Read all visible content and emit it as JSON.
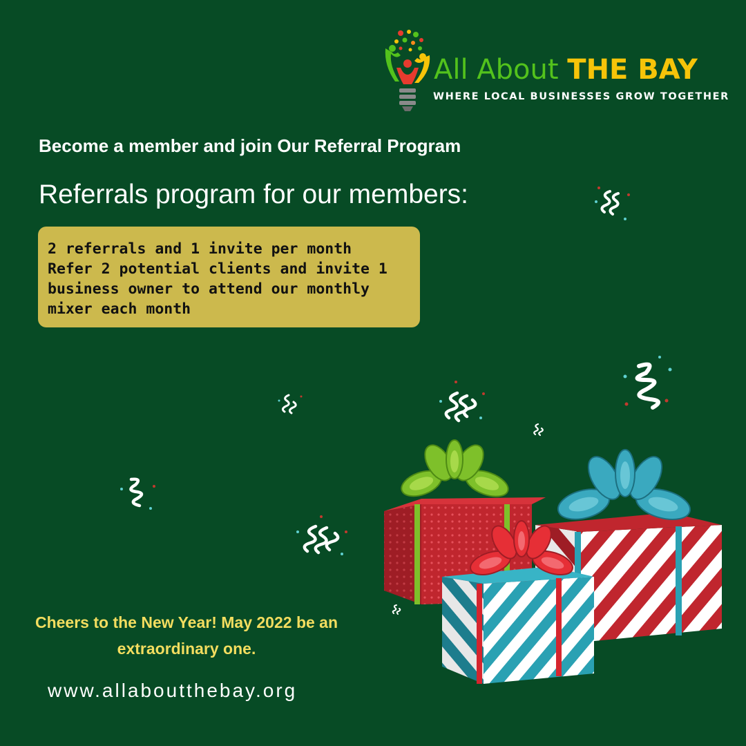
{
  "logo": {
    "brand_part1": "All About ",
    "brand_part2": "THE BAY",
    "tagline": "WHERE LOCAL BUSINESSES GROW TOGETHER",
    "icon": "lightbulb-people-icon"
  },
  "intro": "Become a member and join Our Referral Program",
  "subhead": "Referrals program for our members:",
  "program": {
    "lines": [
      "2 referrals and 1 invite per month",
      "Refer 2 potential clients and invite 1",
      "business owner to attend our monthly",
      "mixer each month"
    ]
  },
  "cheers": "Cheers to the New Year! May 2022 be an extraordinary one.",
  "website": "www.allaboutthebay.org",
  "decorations": {
    "gifts": [
      "red-gift-box-icon",
      "red-white-striped-gift-box-icon",
      "teal-striped-gift-box-icon"
    ],
    "confetti": "streamer-confetti-icon"
  },
  "colors": {
    "background": "#074b25",
    "box": "#ccb94d",
    "accent_yellow": "#f6c409",
    "accent_green": "#53c21c",
    "cheers_text": "#f3dd5f"
  }
}
